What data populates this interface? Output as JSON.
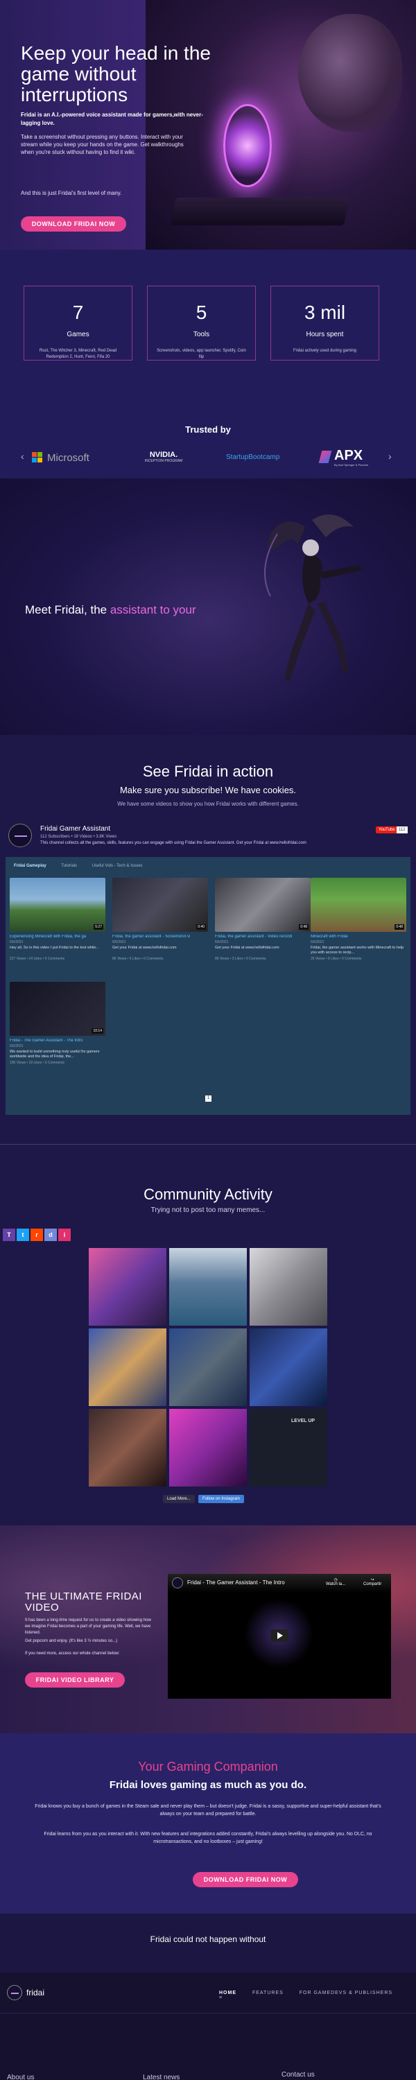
{
  "hero": {
    "title": "Keep your head in the game without interruptions",
    "lead": "Fridai is an A.I.-powered voice assistant made for gamers,with never-lagging love.",
    "para": "Take a screenshot without pressing any buttons. Interact with your stream while you keep your hands on the game. Get walkthroughs when you're stuck without having to find it wiki.",
    "para2": "And this is just Fridai's first level of many.",
    "cta": "DOWNLOAD FRIDAI NOW"
  },
  "stats": [
    {
      "number": "7",
      "label": "Games",
      "sub": "Rust, The Witcher 3, Minecraft, Red Dead Redemption 2, Hunt, Fenri, Fifa 20"
    },
    {
      "number": "5",
      "label": "Tools",
      "sub": "Screenshots, videos, app launcher, Spotify, Coin flip"
    },
    {
      "number": "3 mil",
      "label": "Hours spent",
      "sub": "Fridai actively used during gaming"
    }
  ],
  "trusted": {
    "heading": "Trusted by",
    "logos": [
      "Microsoft",
      "NVIDIA.",
      "INCEPTION PROGRAM",
      "StartupBootcamp",
      "APX",
      "By Axel Springer & Porsche"
    ],
    "prev": "‹",
    "next": "›"
  },
  "meet": {
    "prefix": "Meet Fridai, the ",
    "highlight": "assistant to your"
  },
  "video": {
    "title": "See Fridai in action",
    "subtitle": "Make sure you subscribe! We have cookies.",
    "desc": "We have some videos to show you how Fridai works with different games.",
    "channel_name": "Fridai Gamer Assistant",
    "channel_stats": "112 Subscribers  •  18 Videos  •  3.8K Views",
    "channel_desc": "This channel collects all the games, skills, features you can engage with using Fridai the Gamer Assistant. Get your Fridai at www.hellofridai.com",
    "youtube_label": "YouTube",
    "youtube_count": "112",
    "tabs": [
      "Fridai Gameplay",
      "Tutorials",
      "Useful Vids - Tech & Issues"
    ],
    "cards": [
      {
        "title": "Experiencing Minecraft with Fridai, the ga",
        "date": "5/6/2021",
        "desc": "Hey all, So in this video I put Fridai to the test while...",
        "stats": "227 Views  •  14 Likes  •  5 Comments",
        "duration": "5:27"
      },
      {
        "title": "Fridai, the gamer assistant - Screenshot vi",
        "date": "5/6/2021",
        "desc": "Get your Fridai at www.hellofridai.com",
        "stats": "86 Views  •  5 Likes  •  0 Comments",
        "duration": "0:40"
      },
      {
        "title": "Fridai, the gamer assistant - Video recordi",
        "date": "5/6/2021",
        "desc": "Get your Fridai at www.hellofridai.com",
        "stats": "86 Views  •  3 Likes  •  0 Comments",
        "duration": "0:48"
      },
      {
        "title": "Minecraft with Fridai",
        "date": "5/6/2021",
        "desc": "Fridai, the gamer assistant works with Minecraft to help you with access to recip...",
        "stats": "25 Views  •  0 Likes  •  0 Comments",
        "duration": "0:48"
      },
      {
        "title": "Fridai - The Gamer Assistant - The Intro",
        "date": "5/6/2021",
        "desc": "We wanted to build something truly useful for gamers worldwide and the idea of Fridai, the...",
        "stats": "190 Views  •  19 Likes  •  3 Comments",
        "duration": "10:14"
      }
    ],
    "page": "1"
  },
  "community": {
    "title": "Community Activity",
    "subtitle": "Trying not to post too many memes...",
    "social": [
      "T",
      "t",
      "r",
      "d",
      "i"
    ],
    "load_more": "Load More...",
    "follow": "Follow on Instagram",
    "tile_text": "LEVEL UP"
  },
  "ultimate": {
    "title": "THE ULTIMATE FRIDAI VIDEO",
    "p1": "It has been a long-time request for us to create a video showing how we imagine Fridai becomes a part of your gaming life. Well, we have listened.",
    "p2": "Get popcorn and enjoy. (It's like 3 ½ minutes so...)",
    "p3": "If you need more, access our whole channel below:",
    "cta": "FRIDAI VIDEO LIBRARY",
    "player_title": "Fridai - The Gamer Assistant - The Intro",
    "watch_later": "Watch la...",
    "share": "Compartir"
  },
  "companion": {
    "title": "Your Gaming Companion",
    "subtitle": "Fridai loves gaming as much as you do.",
    "p1": "Fridai knows you buy a bunch of games in the Steam sale and never play them – but doesn't judge. Fridai is a sassy, supportive and super-helpful assistant that's always on your team and prepared for battle.",
    "p2": "Fridai learns from you as you interact with it. With new features and integrations added constantly, Fridai's always levelling up alongside you. No DLC, no microtransactions, and no lootboxes – just gaming!",
    "cta": "DOWNLOAD FRIDAI NOW"
  },
  "without": {
    "text": "Fridai could not happen without"
  },
  "footer": {
    "brand": "fridai",
    "nav": [
      "HOME",
      "FEATURES",
      "FOR GAMEDEVS & PUBLISHERS",
      "≡"
    ],
    "cols": [
      "About us",
      "Latest news",
      "Contact us"
    ]
  }
}
